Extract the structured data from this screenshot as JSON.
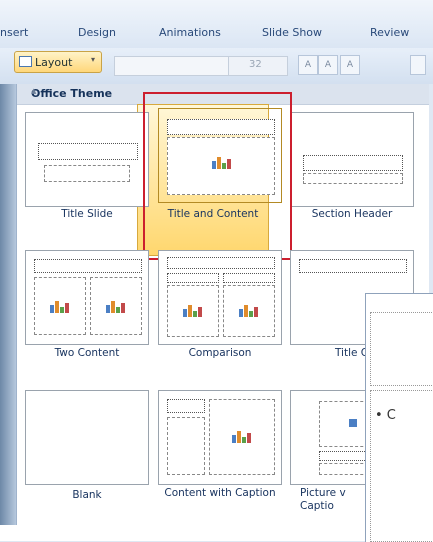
{
  "ribbon": {
    "tabs": [
      {
        "label": "nsert"
      },
      {
        "label": "Design"
      },
      {
        "label": "Animations"
      },
      {
        "label": "Slide Show"
      },
      {
        "label": "Review"
      }
    ],
    "layout_button": {
      "label": "Layout",
      "chevron": "▾",
      "icon": "layout-icon"
    },
    "font_size": "32",
    "font_buttons": [
      "A",
      "A",
      "A"
    ]
  },
  "gallery": {
    "header": "Office Theme",
    "items": [
      {
        "label": "Title Slide",
        "selected": false
      },
      {
        "label": "Title and Content",
        "selected": true
      },
      {
        "label": "Section Header",
        "selected": false
      },
      {
        "label": "Two Content",
        "selected": false
      },
      {
        "label": "Comparison",
        "selected": false
      },
      {
        "label": "Title O",
        "selected": false
      },
      {
        "label": "Blank",
        "selected": false
      },
      {
        "label": "Content with Caption",
        "selected": false
      },
      {
        "label": "Picture v Captio",
        "selected": false
      }
    ],
    "accent_color": "#cc1f2e",
    "selection_color": "#ffd76e"
  },
  "slide": {
    "bullet": "• C"
  }
}
